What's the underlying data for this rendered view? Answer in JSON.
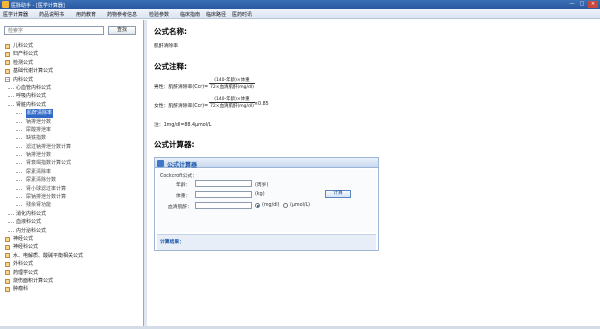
{
  "window": {
    "title": "医脉助手 - [医学计算器]",
    "minimize": "—",
    "maximize": "□",
    "close": "×"
  },
  "menu": [
    "医学计算器",
    "药品说明书",
    "用药教育",
    "药物参考信息",
    "检验参数",
    "临床指南",
    "临床路径",
    "医药时讯"
  ],
  "sidebar": {
    "search_placeholder": "检索字",
    "search_button": "查找",
    "tree": [
      {
        "label": "儿科公式",
        "level": 0,
        "type": "category"
      },
      {
        "label": "妇产科公式",
        "level": 0,
        "type": "category"
      },
      {
        "label": "检测公式",
        "level": 0,
        "type": "category"
      },
      {
        "label": "基础代谢计算公式",
        "level": 0,
        "type": "category"
      },
      {
        "label": "内科公式",
        "level": 0,
        "type": "expanded"
      },
      {
        "label": "心血管内科公式",
        "level": 1,
        "type": "sub"
      },
      {
        "label": "呼吸内科公式",
        "level": 1,
        "type": "sub"
      },
      {
        "label": "肾脏内科公式",
        "level": 1,
        "type": "sub"
      },
      {
        "label": "肌酐清除率",
        "level": 2,
        "type": "selected"
      },
      {
        "label": "钠排泄分数",
        "level": 2,
        "type": "leaf"
      },
      {
        "label": "尿酸排泄率",
        "level": 2,
        "type": "leaf"
      },
      {
        "label": "缺铁指数",
        "level": 2,
        "type": "leaf"
      },
      {
        "label": "滤过钠排泄分数计算",
        "level": 2,
        "type": "leaf"
      },
      {
        "label": "钠排泄分数",
        "level": 2,
        "type": "leaf"
      },
      {
        "label": "肾衰竭指数计算公式",
        "level": 2,
        "type": "leaf"
      },
      {
        "label": "尿素清除率",
        "level": 2,
        "type": "leaf"
      },
      {
        "label": "尿素清除分数",
        "level": 2,
        "type": "leaf"
      },
      {
        "label": "肾小球滤过率计算",
        "level": 2,
        "type": "leaf"
      },
      {
        "label": "尿钠排泄分数计算",
        "level": 2,
        "type": "leaf"
      },
      {
        "label": "残余肾功能",
        "level": 2,
        "type": "leaf"
      },
      {
        "label": "消化内科公式",
        "level": 1,
        "type": "sub"
      },
      {
        "label": "血液科公式",
        "level": 1,
        "type": "sub"
      },
      {
        "label": "内分泌科公式",
        "level": 1,
        "type": "sub"
      },
      {
        "label": "神经公式",
        "level": 0,
        "type": "category"
      },
      {
        "label": "神经科公式",
        "level": 0,
        "type": "category"
      },
      {
        "label": "水、电解质、酸碱平衡相关公式",
        "level": 0,
        "type": "category"
      },
      {
        "label": "外科公式",
        "level": 0,
        "type": "category"
      },
      {
        "label": "药理学公式",
        "level": 0,
        "type": "category"
      },
      {
        "label": "烧伤面积计算公式",
        "level": 0,
        "type": "category"
      },
      {
        "label": "肿瘤科",
        "level": 0,
        "type": "category"
      }
    ]
  },
  "content": {
    "name_heading": "公式名称:",
    "name_value": "肌酐清除率",
    "notes_heading": "公式注释:",
    "male_prefix": "男性：肌酐清除率(Ccr)=",
    "male_num": "(140-年龄)×体重",
    "male_den": "72×血清肌酐(mg/dl)",
    "female_prefix": "女性：肌酐清除率(Ccr)=",
    "female_num": "(140-年龄)×体重",
    "female_den": "72×血清肌酐(mg/dl)",
    "female_suffix": "×0.85",
    "note": "注：1mg/dl=88.4μmol/L",
    "calc_heading": "公式计算器:"
  },
  "calculator": {
    "title": "公式计算器",
    "method": "Cockcroft公式：",
    "fields": [
      {
        "label": "年龄：",
        "unit": "(周岁)"
      },
      {
        "label": "体重：",
        "unit": "(kg)"
      },
      {
        "label": "血清肌酐：",
        "unit": ""
      }
    ],
    "unit_options": [
      "(mg/dl)",
      "(μmol/L)"
    ],
    "selected_unit": "(mg/dl)",
    "button": "计算",
    "result_label": "计算结果："
  }
}
